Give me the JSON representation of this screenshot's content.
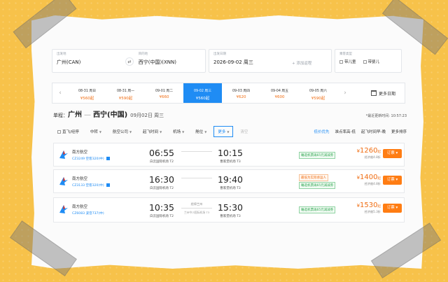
{
  "colors": {
    "accent": "#1f8cf4",
    "price": "#f06d12",
    "book": "#ff7d13",
    "background": "#f7c24a"
  },
  "search": {
    "from": {
      "label": "出发地",
      "value": "广州(CAN)"
    },
    "to": {
      "label": "目的地",
      "value": "西宁(中国)(XNN)"
    },
    "date": {
      "label": "出发日期",
      "value": "2026-09-02 周三",
      "add_return": "+ 添加返程"
    },
    "passengers": {
      "label": "乘客类型",
      "child": "带儿童",
      "infant": "带婴儿"
    },
    "swap_icon": "swap-arrows-icon"
  },
  "dates": [
    {
      "day": "08-31 周日",
      "price": "¥560起"
    },
    {
      "day": "08-31 周一",
      "price": "¥590起"
    },
    {
      "day": "09-01 周二",
      "price": "¥660"
    },
    {
      "day": "09-02 周三",
      "price": "¥560起"
    },
    {
      "day": "09-03 周四",
      "price": "¥620"
    },
    {
      "day": "09-04 周五",
      "price": "¥600"
    },
    {
      "day": "09-05 周六",
      "price": "¥590起"
    }
  ],
  "more_dates": "更多日期",
  "route": {
    "prefix": "单程：",
    "from": "广州",
    "to": "西宁(中国)",
    "date": "09月02日 周三",
    "updated": "*最近更新时间: 10:57:23"
  },
  "filters": {
    "direct": "直飞/经停",
    "transfer": "中转",
    "airline": "航空公司",
    "time": "起飞时间",
    "airport": "机场",
    "cabin": "舱位",
    "more": "更多",
    "clear": "清空",
    "sorts": [
      "低价优先",
      "准点率高-低",
      "起飞时间早-晚",
      "更多排序"
    ]
  },
  "flights": [
    {
      "airline": "南方航空",
      "code": "CZ3249 空客320(中)",
      "dep_time": "06:55",
      "dep_airport": "白云国际机场 T2",
      "arr_time": "10:15",
      "arr_airport": "曹家堡机场 T3",
      "stop": "",
      "stop_detail": "",
      "badge": "睡选机票再65元减减券",
      "badge_style": "green",
      "price": "1260",
      "currency": "¥",
      "qi": "起",
      "price_note": "经济舱4.8折",
      "book": "订票"
    },
    {
      "airline": "南方航空",
      "code": "CZ3133 空客320(中)",
      "dep_time": "16:30",
      "dep_airport": "白云国际机场 T2",
      "arr_time": "19:40",
      "arr_airport": "曹家堡机场 T3",
      "stop": "",
      "stop_detail": "",
      "badge": "最低为实际承运人",
      "badge2": "睡选机票再65元减减券",
      "badge_style": "orange",
      "price": "1400",
      "currency": "¥",
      "qi": "起",
      "price_note": "经济舱4.8折",
      "book": "订票"
    },
    {
      "airline": "南方航空",
      "code": "CZ6083 波音737(中)",
      "dep_time": "10:35",
      "dep_airport": "白云国际机场 T2",
      "arr_time": "15:30",
      "arr_airport": "曹家堡机场 T3",
      "stop": "经停兰州",
      "stop_detail": "兰州中川国际机场 T3",
      "badge": "睡选机票再65元减减券",
      "badge_style": "green",
      "price": "1530",
      "currency": "¥",
      "qi": "起",
      "price_note": "经济舱5.3折",
      "book": "订票"
    }
  ]
}
